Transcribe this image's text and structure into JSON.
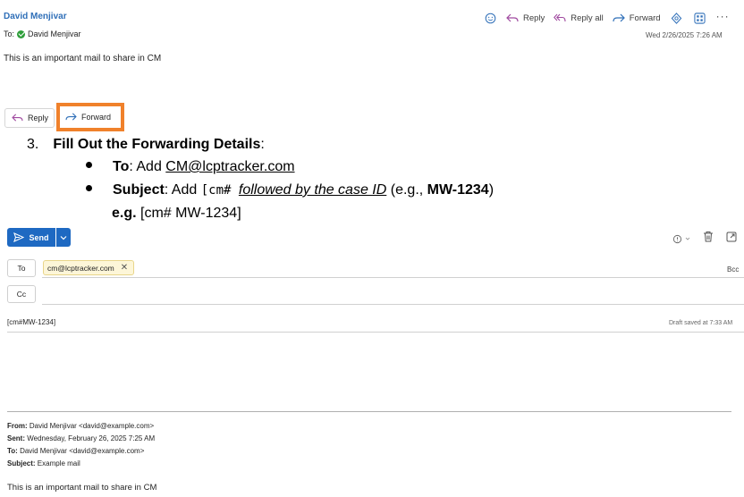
{
  "email": {
    "sender": "David Menjivar",
    "to_label": "To:",
    "to_name": "David Menjivar",
    "date": "Wed 2/26/2025 7:26 AM",
    "body": "This is an important mail to share in CM",
    "actions": {
      "reply": "Reply",
      "reply_all": "Reply all",
      "forward": "Forward"
    }
  },
  "inline_buttons": {
    "reply": "Reply",
    "forward": "Forward"
  },
  "highlight_color": "#f0812b",
  "instructions": {
    "step_number": "3.",
    "step_title": "Fill Out the Forwarding Details",
    "step_colon": ":",
    "to_label": "To",
    "to_text": ": Add ",
    "to_address": "CM@lcptracker.com",
    "subject_label": "Subject",
    "subject_text": ": Add ",
    "subject_code": "[cm# ",
    "subject_italic": "followed by the case ID",
    "subject_eg": " (e.g., ",
    "subject_example": "MW-1234",
    "subject_close": ")",
    "eg_label": "e.g.",
    "eg_value": " [cm# MW-1234]"
  },
  "compose": {
    "send_label": "Send",
    "send_color": "#1e69c2",
    "to_button": "To",
    "cc_button": "Cc",
    "recipient_chip": "cm@lcptracker.com",
    "bcc": "Bcc",
    "subject_value": "[cm#MW-1234]",
    "draft_status": "Draft saved at 7:33 AM",
    "quoted": {
      "from_label": "From:",
      "from_value": " David Menjivar <david@example.com>",
      "sent_label": "Sent:",
      "sent_value": " Wednesday, February 26, 2025 7:25 AM",
      "to_label": "To:",
      "to_value": " David Menjivar <david@example.com>",
      "subject_label": "Subject:",
      "subject_value": " Example mail",
      "body": "This is an important mail to share in CM"
    }
  },
  "icons": {
    "emoji": "smiley-icon",
    "reply": "reply-arrow-icon",
    "reply_all": "reply-all-arrow-icon",
    "forward": "forward-arrow-icon",
    "copilot": "copilot-icon",
    "apps": "apps-grid-icon",
    "more": "more-icon",
    "send": "send-icon",
    "sensitivity": "shield-icon",
    "discard": "trash-icon",
    "popout": "popout-icon"
  }
}
